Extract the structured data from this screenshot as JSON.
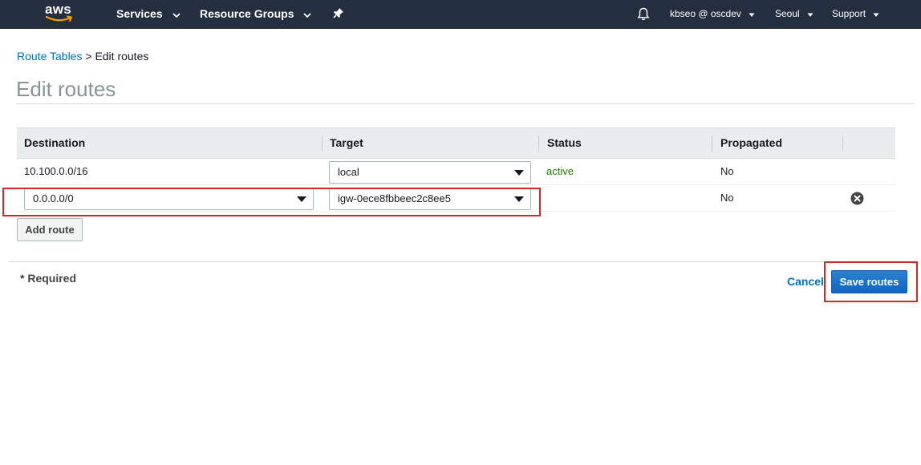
{
  "nav": {
    "logo_text": "aws",
    "services_label": "Services",
    "resource_groups_label": "Resource Groups",
    "account_label": "kbseo @ oscdev",
    "region_label": "Seoul",
    "support_label": "Support",
    "icons": [
      "bell-icon",
      "pin-icon",
      "chevron-down-icon"
    ]
  },
  "breadcrumb": {
    "parent": "Route Tables",
    "separator": ">",
    "current": "Edit routes"
  },
  "page_title": "Edit routes",
  "table": {
    "columns": [
      "Destination",
      "Target",
      "Status",
      "Propagated"
    ],
    "rows": [
      {
        "destination": "10.100.0.0/16",
        "target": "local",
        "status": "active",
        "propagated": "No"
      },
      {
        "destination": "0.0.0.0/0",
        "target": "igw-0ece8fbbeec2c8ee5",
        "status": "",
        "propagated": "No"
      }
    ]
  },
  "add_route_label": "Add route",
  "footer": {
    "required_label": "* Required",
    "cancel_label": "Cancel",
    "save_label": "Save routes"
  },
  "colors": {
    "nav_bg": "#232f3e",
    "link": "#0073bb",
    "status_active": "#1d8102",
    "highlight": "#d0282b",
    "primary_button": "#1166bb"
  }
}
